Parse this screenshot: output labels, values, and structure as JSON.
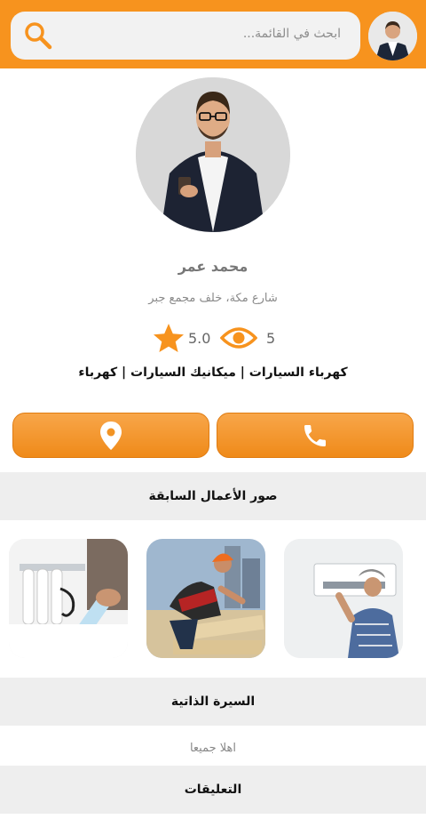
{
  "search": {
    "placeholder": "ابحث في القائمة..."
  },
  "profile": {
    "name": "محمد عمر",
    "address": "شارع مكة، خلف مجمع جبر",
    "rating": "5.0",
    "views": "5",
    "categories": "كهرباء السيارات  |  ميكانيك السيارات | كهرباء"
  },
  "icons": {
    "search": "magnifier-icon",
    "rating": "star-icon",
    "views": "eye-icon",
    "location": "map-pin-icon",
    "call": "phone-icon"
  },
  "sections": {
    "works_title": "صور الأعمال السابقة",
    "bio_title": "السيرة الذاتية",
    "bio_text": "اهلا جميعا",
    "comments_title": "التعليقات"
  },
  "colors": {
    "accent": "#f7931e",
    "section_bg": "#eeeeee"
  }
}
